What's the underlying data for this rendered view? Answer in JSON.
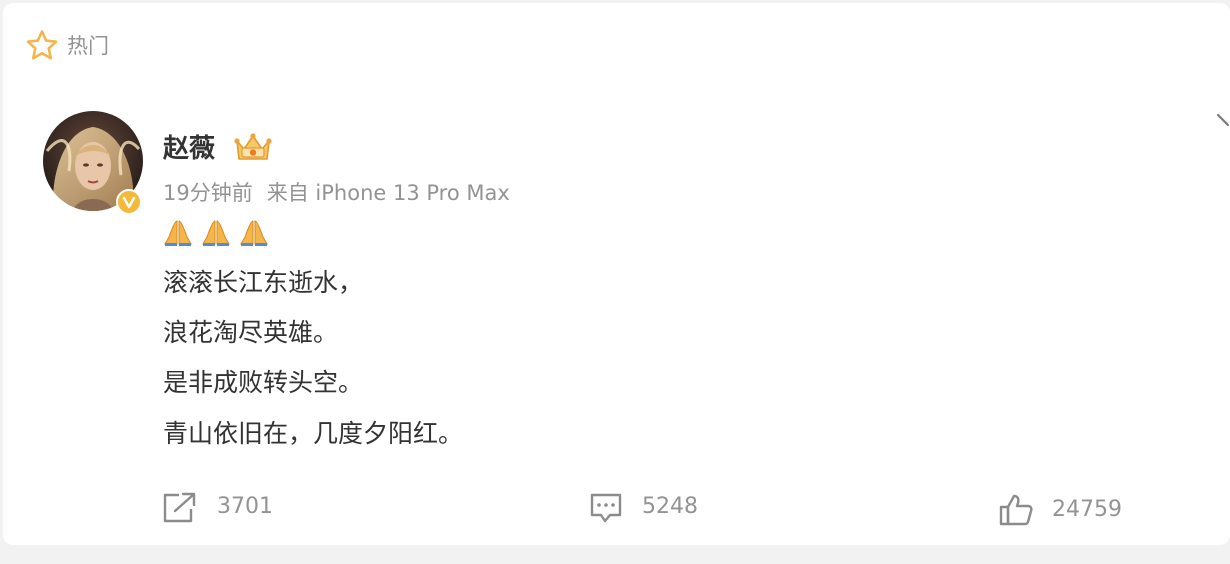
{
  "hot_section": {
    "label": "热门",
    "icon": "star-icon",
    "accent_color": "#f5b54d"
  },
  "post": {
    "author": {
      "name": "赵薇",
      "avatar": "avatar",
      "verified_icon": "verified-v-icon",
      "vip_icon": "vip-crown-icon"
    },
    "meta": {
      "time": "19分钟前",
      "source": "来自 iPhone 13 Pro Max"
    },
    "emojis": [
      "🙏",
      "🙏",
      "🙏"
    ],
    "lines": [
      "滚滚长江东逝水，",
      "浪花淘尽英雄。",
      "是非成败转头空。",
      "青山依旧在，几度夕阳红。"
    ],
    "actions": {
      "repost": {
        "icon": "repost-icon",
        "count": "3701"
      },
      "comment": {
        "icon": "comment-icon",
        "count": "5248"
      },
      "like": {
        "icon": "thumbs-up-icon",
        "count": "24759"
      }
    },
    "menu_icon": "chevron-down-icon"
  }
}
